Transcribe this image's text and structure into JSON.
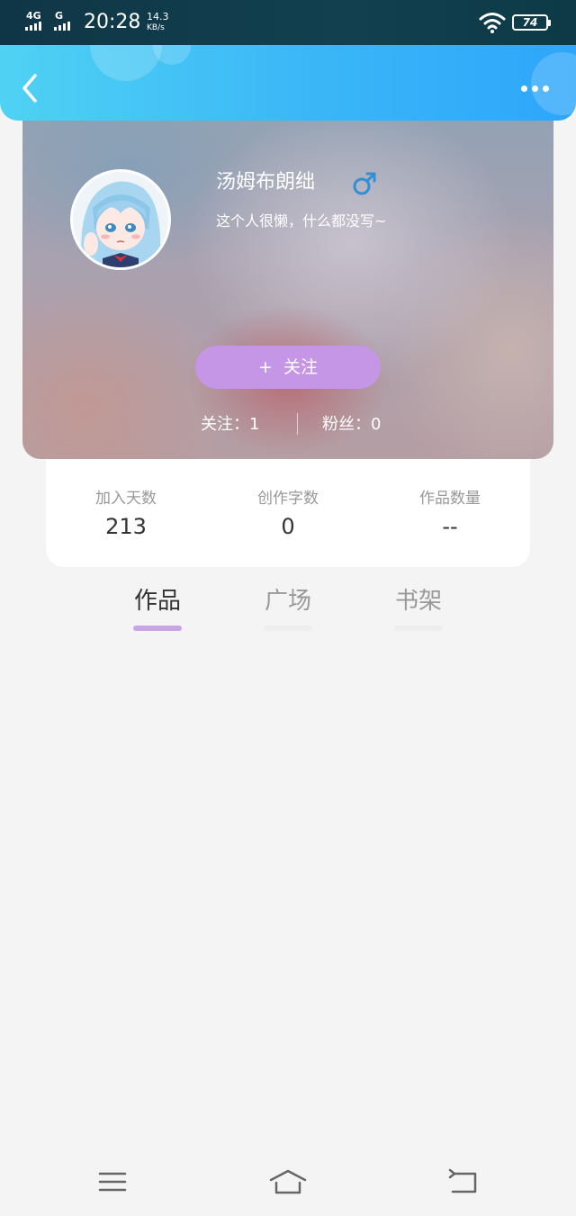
{
  "status_bar": {
    "network_1": "4G",
    "network_2": "G",
    "time": "20:28",
    "speed_value": "14.3",
    "speed_unit": "KB/s",
    "battery": "74",
    "icons": [
      "signal-icon",
      "wifi-icon",
      "battery-icon"
    ]
  },
  "header": {
    "back_icon": "chevron-left-icon",
    "more_icon": "more-dots-icon",
    "gradient_start": "#4fd2f4",
    "gradient_end": "#2ea6fb"
  },
  "profile": {
    "nickname": "汤姆布朗绌",
    "gender_icon": "male-icon",
    "gender_symbol": "♂",
    "gender_color": "#2f8fd8",
    "bio": "这个人很懒，什么都没写~",
    "avatar": "anime-girl-avatar",
    "follow_plus": "+",
    "follow_label": "关注",
    "follow_color": "#c596e6",
    "following": "关注：1",
    "followers": "粉丝：0"
  },
  "stats": [
    {
      "label": "加入天数",
      "value": "213"
    },
    {
      "label": "创作字数",
      "value": "0"
    },
    {
      "label": "作品数量",
      "value": "--"
    }
  ],
  "tabs": [
    {
      "label": "作品",
      "active": true
    },
    {
      "label": "广场",
      "active": false
    },
    {
      "label": "书架",
      "active": false
    }
  ],
  "accent_color": "#c7a5e7",
  "nav_icons": [
    "menu-icon",
    "home-icon",
    "back-icon"
  ]
}
